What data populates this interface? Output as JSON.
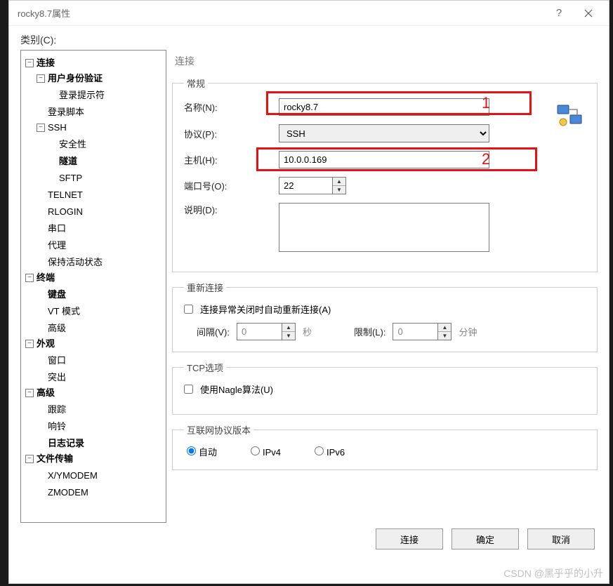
{
  "window": {
    "title": "rocky8.7属性"
  },
  "categoryLabel": "类别(C):",
  "tree": {
    "conn": "连接",
    "auth": "用户身份验证",
    "loginPrompt": "登录提示符",
    "loginScript": "登录脚本",
    "ssh": "SSH",
    "security": "安全性",
    "tunnel": "隧道",
    "sftp": "SFTP",
    "telnet": "TELNET",
    "rlogin": "RLOGIN",
    "serial": "串口",
    "proxy": "代理",
    "keepalive": "保持活动状态",
    "terminal": "终端",
    "keyboard": "键盘",
    "vt": "VT 模式",
    "adv1": "高级",
    "appearance": "外观",
    "windowNode": "窗口",
    "highlight": "突出",
    "advanced": "高级",
    "trace": "跟踪",
    "bell": "响铃",
    "logging": "日志记录",
    "filetransfer": "文件传输",
    "xymodem": "X/YMODEM",
    "zmodem": "ZMODEM"
  },
  "right": {
    "header": "连接",
    "general": {
      "legend": "常规",
      "nameLabel": "名称(N):",
      "nameValue": "rocky8.7",
      "protoLabel": "协议(P):",
      "protoValue": "SSH",
      "hostLabel": "主机(H):",
      "hostValue": "10.0.0.169",
      "portLabel": "端口号(O):",
      "portValue": "22",
      "descLabel": "说明(D):",
      "anno1": "1",
      "anno2": "2"
    },
    "reconnect": {
      "legend": "重新连接",
      "autoLabel": "连接异常关闭时自动重新连接(A)",
      "intervalLabel": "间隔(V):",
      "intervalValue": "0",
      "secUnit": "秒",
      "limitLabel": "限制(L):",
      "limitValue": "0",
      "minUnit": "分钟"
    },
    "tcp": {
      "legend": "TCP选项",
      "nagleLabel": "使用Nagle算法(U)"
    },
    "ipver": {
      "legend": "互联网协议版本",
      "auto": "自动",
      "ipv4": "IPv4",
      "ipv6": "IPv6"
    }
  },
  "buttons": {
    "connect": "连接",
    "ok": "确定",
    "cancel": "取消"
  },
  "watermark": "CSDN @黑乎乎的小升"
}
